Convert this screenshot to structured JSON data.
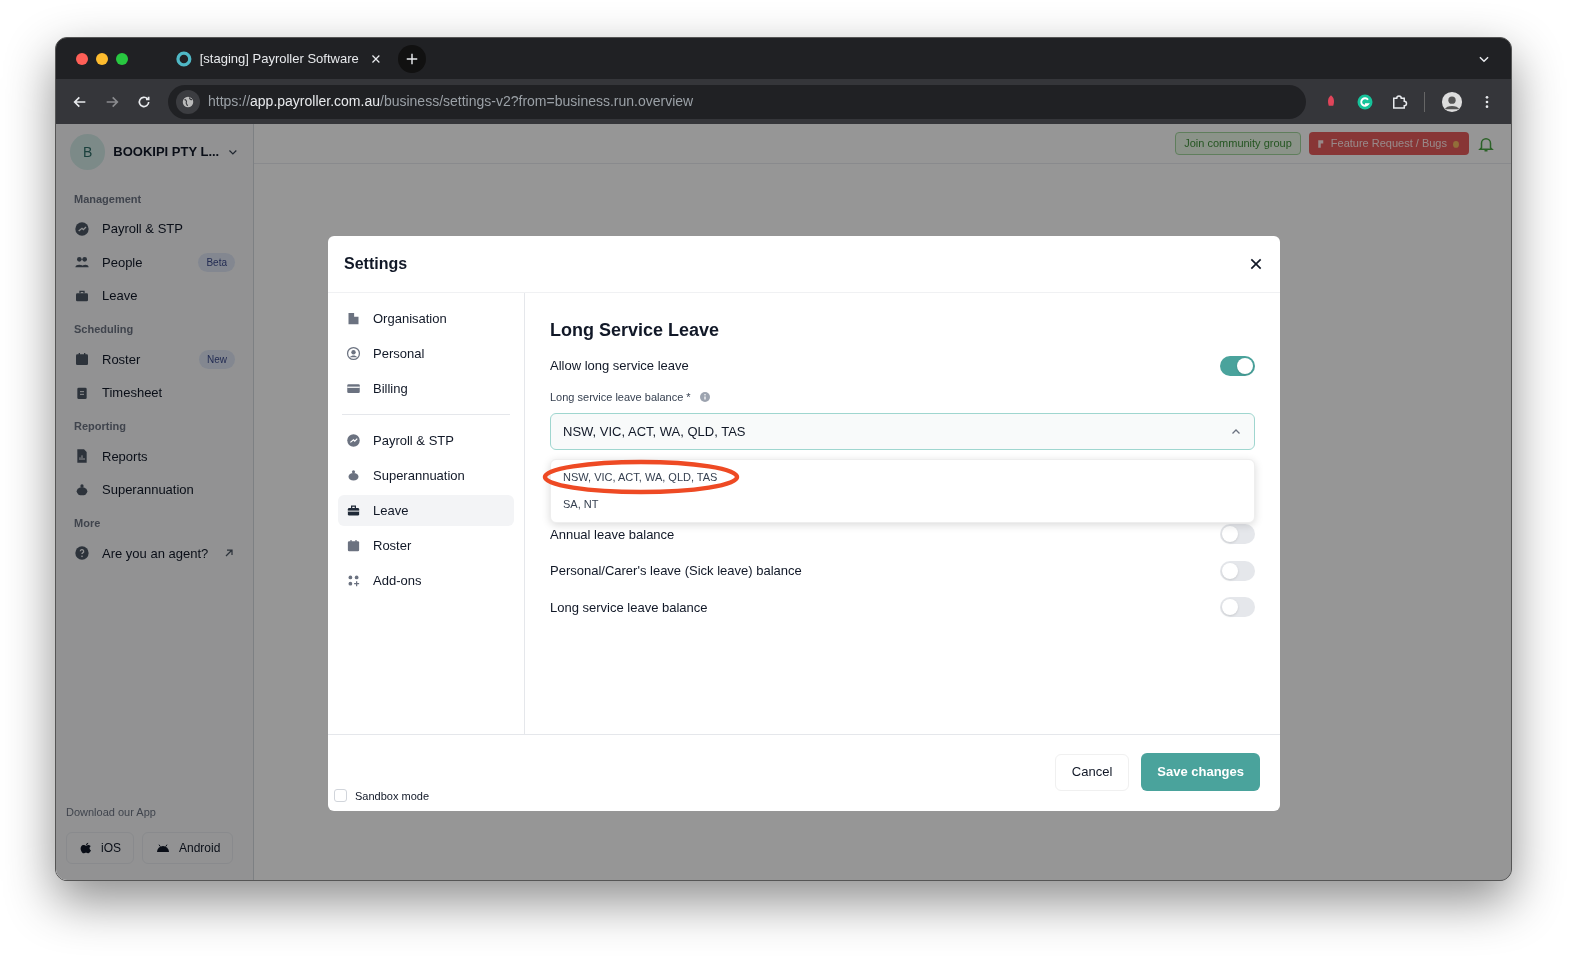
{
  "browser": {
    "tab_title": "[staging] Payroller Software",
    "url": {
      "scheme": "https://",
      "host": "app.payroller.com.au",
      "path": "/business/settings-v2?from=business.run.overview"
    }
  },
  "sidebar": {
    "company": {
      "avatar_letter": "B",
      "name": "BOOKIPI PTY L..."
    },
    "sections": [
      {
        "title": "Management",
        "items": [
          {
            "label": "Payroll & STP"
          },
          {
            "label": "People",
            "badge": "Beta"
          },
          {
            "label": "Leave"
          }
        ]
      },
      {
        "title": "Scheduling",
        "items": [
          {
            "label": "Roster",
            "badge": "New"
          },
          {
            "label": "Timesheet"
          }
        ]
      },
      {
        "title": "Reporting",
        "items": [
          {
            "label": "Reports"
          },
          {
            "label": "Superannuation"
          }
        ]
      },
      {
        "title": "More",
        "items": [
          {
            "label": "Are you an agent?",
            "external": true
          }
        ]
      }
    ],
    "download": {
      "title": "Download our App",
      "buttons": [
        "iOS",
        "Android"
      ]
    }
  },
  "top_bar": {
    "community_button": "Join community group",
    "feature_button": "Feature Request / Bugs"
  },
  "modal": {
    "title": "Settings",
    "nav_groups": [
      [
        {
          "label": "Organisation",
          "selected": false
        },
        {
          "label": "Personal",
          "selected": false
        },
        {
          "label": "Billing",
          "selected": false
        }
      ],
      [
        {
          "label": "Payroll & STP",
          "selected": false
        },
        {
          "label": "Superannuation",
          "selected": false
        },
        {
          "label": "Leave",
          "selected": true
        },
        {
          "label": "Roster",
          "selected": false
        },
        {
          "label": "Add-ons",
          "selected": false
        }
      ]
    ],
    "heading": "Long Service Leave",
    "allow_toggle": {
      "label": "Allow long service leave",
      "on": true
    },
    "balance_field": {
      "label": "Long service leave balance *",
      "value": "NSW, VIC, ACT, WA, QLD, TAS",
      "expanded": true,
      "options": [
        {
          "label": "NSW, VIC, ACT, WA, QLD, TAS",
          "circled": true
        },
        {
          "label": "SA, NT",
          "circled": false
        }
      ]
    },
    "toggles": [
      {
        "label": "Annual leave balance",
        "on": false
      },
      {
        "label": "Personal/Carer's leave (Sick leave) balance",
        "on": false
      },
      {
        "label": "Long service leave balance",
        "on": false
      }
    ],
    "sandbox": {
      "label": "Sandbox mode",
      "checked": false
    },
    "buttons": {
      "cancel": "Cancel",
      "save": "Save changes"
    }
  }
}
